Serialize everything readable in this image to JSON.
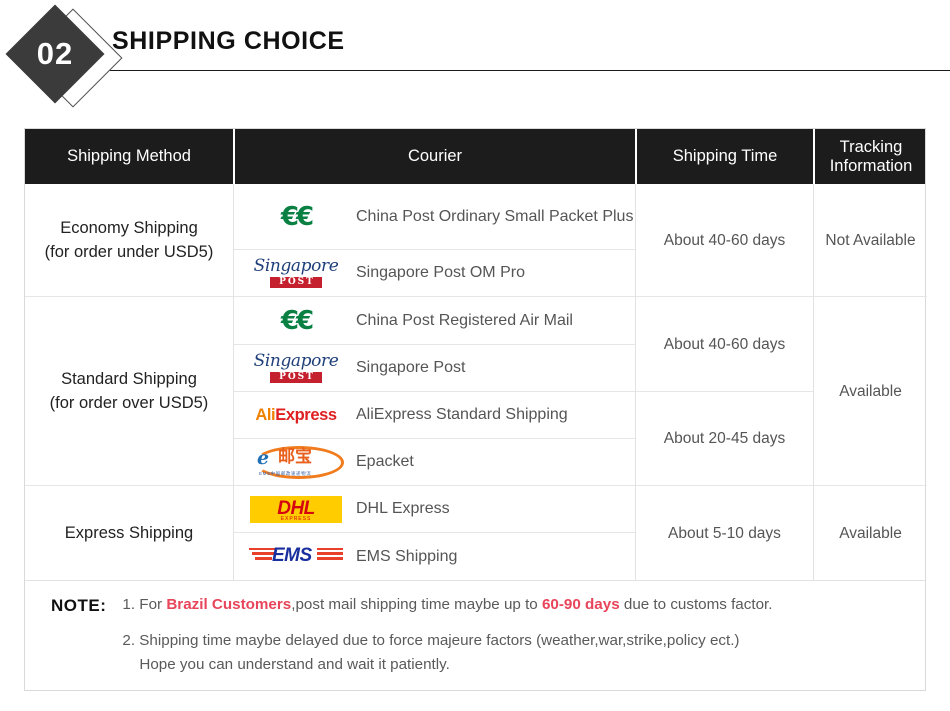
{
  "header": {
    "badge_number": "02",
    "title": "SHIPPING CHOICE"
  },
  "table": {
    "columns": {
      "method": "Shipping Method",
      "courier": "Courier",
      "time": "Shipping Time",
      "tracking": "Tracking Information"
    },
    "methods": [
      {
        "name": "Economy Shipping",
        "sub": "(for order under USD5)"
      },
      {
        "name": "Standard Shipping",
        "sub": "(for order over USD5)"
      },
      {
        "name": "Express Shipping",
        "sub": ""
      }
    ],
    "couriers": [
      {
        "logo": "china-post-logo",
        "name": "China Post Ordinary Small Packet Plus"
      },
      {
        "logo": "singapore-post-logo",
        "name": "Singapore Post OM Pro"
      },
      {
        "logo": "china-post-logo",
        "name": "China Post Registered Air Mail"
      },
      {
        "logo": "singapore-post-logo",
        "name": "Singapore Post"
      },
      {
        "logo": "aliexpress-logo",
        "name": "AliExpress Standard Shipping"
      },
      {
        "logo": "epacket-logo",
        "name": "Epacket"
      },
      {
        "logo": "dhl-logo",
        "name": "DHL Express"
      },
      {
        "logo": "ems-logo",
        "name": "EMS Shipping"
      }
    ],
    "times": [
      "About 40-60 days",
      "About 40-60 days",
      "About 20-45 days",
      "About 5-10 days"
    ],
    "tracking": [
      "Not Available",
      "Available",
      "Available"
    ],
    "logo_text": {
      "china_post": "€€",
      "singapore_script": "Singapore",
      "singapore_post": "POST",
      "ali": "Ali",
      "express": "Express",
      "epacket_e": "e",
      "epacket_cn": "邮宝",
      "epacket_sub": "EMS中国邮政速递物流",
      "dhl": "DHL",
      "dhl_sub": "EXPRESS",
      "ems": "EMS"
    }
  },
  "note": {
    "label": "NOTE:",
    "item1_num": "1.",
    "item1_part1": "For ",
    "item1_hl1": "Brazil Customers",
    "item1_part2": ",post mail shipping time maybe up to ",
    "item1_hl2": "60-90 days",
    "item1_part3": " due to customs factor.",
    "item2_num": "2.",
    "item2_line1": "Shipping time maybe delayed due to force majeure factors (weather,war,strike,policy ect.)",
    "item2_line2": "Hope you can understand and wait it patiently."
  }
}
